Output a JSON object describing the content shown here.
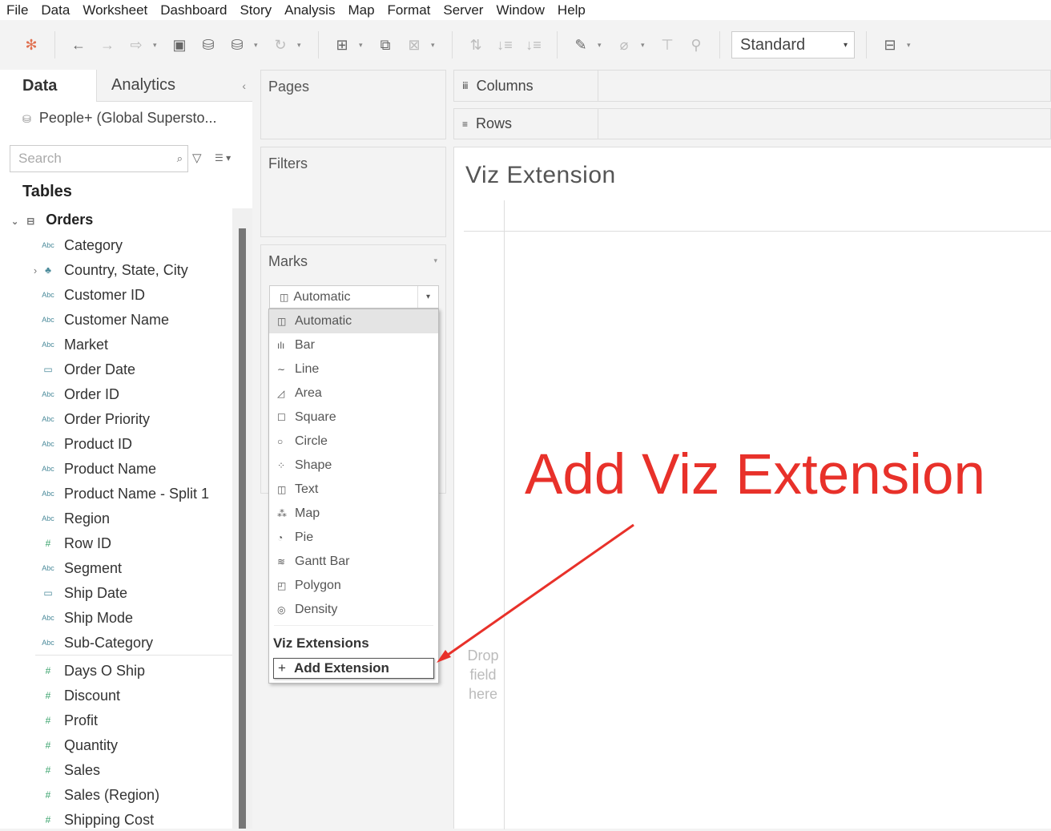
{
  "menu": [
    "File",
    "Data",
    "Worksheet",
    "Dashboard",
    "Story",
    "Analysis",
    "Map",
    "Format",
    "Server",
    "Window",
    "Help"
  ],
  "toolbar": {
    "fit_select": "Standard"
  },
  "left": {
    "tabs": [
      "Data",
      "Analytics"
    ],
    "datasource": "People+ (Global Supersto...",
    "search_placeholder": "Search",
    "tables_label": "Tables",
    "table_name": "Orders",
    "fields": [
      {
        "name": "Category",
        "type": "Abc"
      },
      {
        "name": "Country, State, City",
        "type": "hier"
      },
      {
        "name": "Customer ID",
        "type": "Abc"
      },
      {
        "name": "Customer Name",
        "type": "Abc"
      },
      {
        "name": "Market",
        "type": "Abc"
      },
      {
        "name": "Order Date",
        "type": "date"
      },
      {
        "name": "Order ID",
        "type": "Abc"
      },
      {
        "name": "Order Priority",
        "type": "Abc"
      },
      {
        "name": "Product ID",
        "type": "Abc"
      },
      {
        "name": "Product Name",
        "type": "Abc"
      },
      {
        "name": "Product Name - Split 1",
        "type": "Abc"
      },
      {
        "name": "Region",
        "type": "Abc"
      },
      {
        "name": "Row ID",
        "type": "#"
      },
      {
        "name": "Segment",
        "type": "Abc"
      },
      {
        "name": "Ship Date",
        "type": "date"
      },
      {
        "name": "Ship Mode",
        "type": "Abc"
      },
      {
        "name": "Sub-Category",
        "type": "Abc"
      }
    ],
    "measures": [
      {
        "name": "Days O Ship",
        "type": "#"
      },
      {
        "name": "Discount",
        "type": "#"
      },
      {
        "name": "Profit",
        "type": "#"
      },
      {
        "name": "Quantity",
        "type": "#"
      },
      {
        "name": "Sales",
        "type": "#"
      },
      {
        "name": "Sales (Region)",
        "type": "#"
      },
      {
        "name": "Shipping Cost",
        "type": "#"
      }
    ]
  },
  "cards": {
    "pages": "Pages",
    "filters": "Filters",
    "marks": "Marks",
    "mark_type": "Automatic"
  },
  "shelves": {
    "columns": "Columns",
    "rows": "Rows"
  },
  "viz": {
    "title": "Viz Extension",
    "drop_hint": "Drop field here"
  },
  "mark_menu": {
    "items": [
      {
        "label": "Automatic",
        "icon": "◫"
      },
      {
        "label": "Bar",
        "icon": "ılı"
      },
      {
        "label": "Line",
        "icon": "∼"
      },
      {
        "label": "Area",
        "icon": "◿"
      },
      {
        "label": "Square",
        "icon": "☐"
      },
      {
        "label": "Circle",
        "icon": "○"
      },
      {
        "label": "Shape",
        "icon": "⁘"
      },
      {
        "label": "Text",
        "icon": "◫"
      },
      {
        "label": "Map",
        "icon": "⁂"
      },
      {
        "label": "Pie",
        "icon": "◔"
      },
      {
        "label": "Gantt Bar",
        "icon": "≋"
      },
      {
        "label": "Polygon",
        "icon": "◰"
      },
      {
        "label": "Density",
        "icon": "◎"
      }
    ],
    "section": "Viz Extensions",
    "add": "Add Extension"
  },
  "annotation": {
    "text": "Add Viz Extension",
    "color": "#e8312a"
  }
}
